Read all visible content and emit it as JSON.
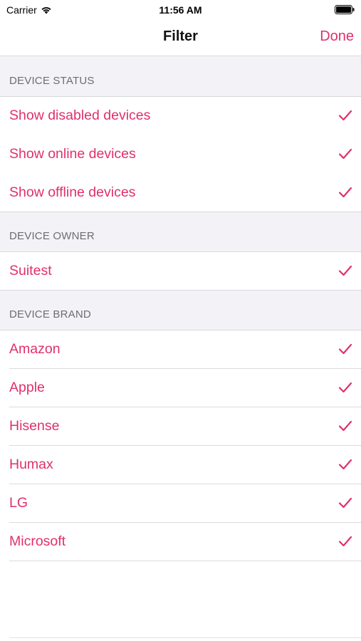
{
  "status_bar": {
    "carrier": "Carrier",
    "time": "11:56 AM",
    "wifi_icon": "wifi-icon",
    "battery_icon": "battery-icon"
  },
  "nav": {
    "title": "Filter",
    "done_label": "Done"
  },
  "accent_color": "#e0306b",
  "sections": [
    {
      "header": "DEVICE STATUS",
      "items": [
        {
          "label": "Show disabled devices",
          "checked": true
        },
        {
          "label": "Show online devices",
          "checked": true
        },
        {
          "label": "Show offline devices",
          "checked": true
        }
      ]
    },
    {
      "header": "DEVICE OWNER",
      "items": [
        {
          "label": "Suitest",
          "checked": true
        }
      ]
    },
    {
      "header": "DEVICE BRAND",
      "items": [
        {
          "label": "Amazon",
          "checked": true
        },
        {
          "label": "Apple",
          "checked": true
        },
        {
          "label": "Hisense",
          "checked": true
        },
        {
          "label": "Humax",
          "checked": true
        },
        {
          "label": "LG",
          "checked": true
        },
        {
          "label": "Microsoft",
          "checked": true
        }
      ]
    }
  ]
}
